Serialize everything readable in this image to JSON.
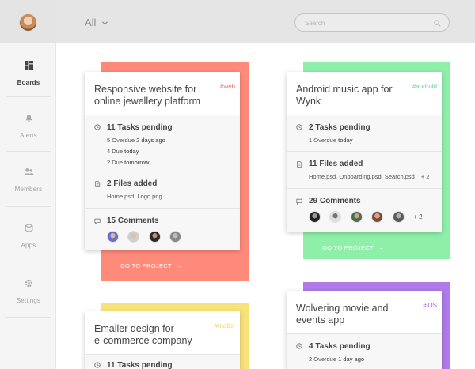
{
  "topbar": {
    "filter_label": "All",
    "search_placeholder": "Search"
  },
  "sidebar": {
    "items": [
      {
        "label": "Boards"
      },
      {
        "label": "Alerts"
      },
      {
        "label": "Members"
      },
      {
        "label": "Apps"
      },
      {
        "label": "Settings"
      }
    ]
  },
  "cards": [
    {
      "title_line1": "Responsive website for",
      "title_line2": "online jewellery platform",
      "tag": "#web",
      "tasks": "11 Tasks pending",
      "overdue_count": "5 Overdue",
      "overdue_when": "2 days ago",
      "due1_count": "4 Due",
      "due1_when": "today",
      "due2_count": "2 Due",
      "due2_when": "tomorrow",
      "files": "2 Files added",
      "file_names": "Home.psd, Logo.png",
      "comments": "15 Comments",
      "goto": "GO TO PROJECT",
      "color": "#ff8a7a"
    },
    {
      "title_line1": "Android music app for",
      "title_line2": "Wynk",
      "tag": "#android",
      "tasks": "2 Tasks pending",
      "overdue_count": "1 Overdue",
      "overdue_when": "today",
      "files": "11 Files added",
      "file_names": "Home.psd, Onboarding.psd, Search.psd",
      "files_more": "+ 2",
      "comments": "29 Comments",
      "comments_more": "+ 2",
      "goto": "GO TO PROJECT",
      "color": "#8ef0a8"
    },
    {
      "title_line1": "Emailer design for",
      "title_line2": "e-commerce company",
      "tag": "#mailer",
      "tasks": "11 Tasks pending",
      "color": "#f8e27a"
    },
    {
      "title_line1": "Wolvering movie and",
      "title_line2": "events app",
      "tag": "#iOS",
      "tasks": "4 Tasks pending",
      "overdue_count": "2 Overdue",
      "overdue_when": "1 day ago",
      "color": "#b07ae8"
    }
  ],
  "colors": {
    "web": "#ff6f5e",
    "android": "#58e08a",
    "mailer": "#f4d84a",
    "ios": "#a45ae0"
  }
}
